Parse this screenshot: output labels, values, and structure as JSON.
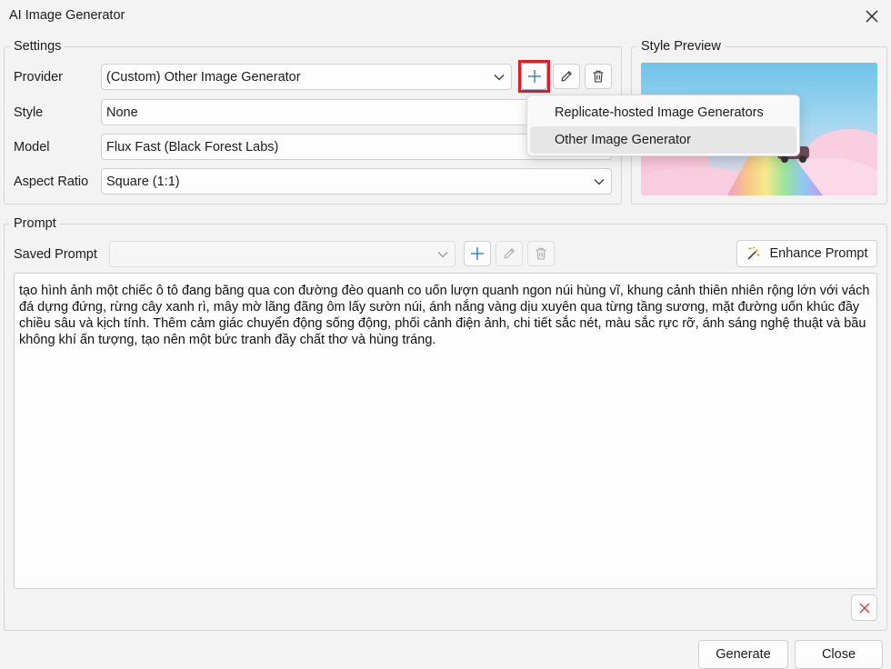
{
  "window": {
    "title": "AI Image Generator"
  },
  "settings": {
    "legend": "Settings",
    "provider": {
      "label": "Provider",
      "value": "(Custom) Other Image Generator"
    },
    "style": {
      "label": "Style",
      "value": "None"
    },
    "model": {
      "label": "Model",
      "value": "Flux Fast (Black Forest Labs)"
    },
    "aspect_ratio": {
      "label": "Aspect Ratio",
      "value": "Square (1:1)"
    }
  },
  "add_provider_menu": {
    "items": [
      "Replicate-hosted Image Generators",
      "Other Image Generator"
    ],
    "highlighted_index": 1
  },
  "style_preview": {
    "legend": "Style Preview"
  },
  "prompt": {
    "legend": "Prompt",
    "saved_prompt_label": "Saved Prompt",
    "saved_prompt_value": "",
    "enhance_label": "Enhance Prompt",
    "text": "tạo hình ảnh một chiếc ô tô đang băng qua con đường đèo quanh co uốn lượn quanh ngon núi hùng vĩ, khung cảnh thiên nhiên rộng lớn với vách đá dựng đứng, rừng cây xanh rì, mây mờ lãng đãng ôm lấy sườn núi, ánh nắng vàng dịu xuyên qua từng tầng sương, mặt đường uốn khúc đầy chiều sâu và kịch tính. Thêm cảm giác chuyển động sống động, phối cảnh điện ảnh, chi tiết sắc nét, màu sắc rực rỡ, ánh sáng nghệ thuật và bầu không khí ấn tượng, tạo nên một bức tranh đầy chất thơ và hùng tráng."
  },
  "footer": {
    "generate_label": "Generate",
    "close_label": "Close"
  },
  "colors": {
    "accent_blue": "#1a73c8",
    "highlight_red": "#e01b24",
    "clear_red": "#d83b3b"
  },
  "icons": [
    "close-icon",
    "chevron-down-icon",
    "plus-icon",
    "pencil-icon",
    "trash-icon",
    "magic-wand-icon",
    "clear-x-icon"
  ]
}
